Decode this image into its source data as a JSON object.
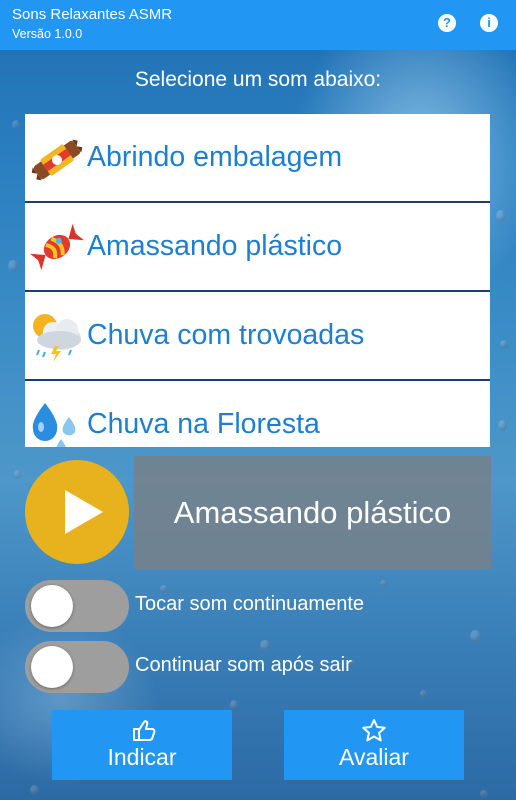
{
  "appbar": {
    "title": "Sons Relaxantes ASMR",
    "version": "Versão 1.0.0",
    "help_icon": "?",
    "info_icon": "i"
  },
  "prompt": "Selecione um som abaixo:",
  "sounds": [
    {
      "label": "Abrindo embalagem",
      "icon": "candy-bar-icon"
    },
    {
      "label": "Amassando plástico",
      "icon": "wrapped-candy-icon"
    },
    {
      "label": "Chuva com trovoadas",
      "icon": "thunderstorm-cloud-icon"
    },
    {
      "label": "Chuva na Floresta",
      "icon": "raindrops-icon"
    }
  ],
  "player": {
    "current_sound": "Amassando plástico",
    "play_icon": "play-icon"
  },
  "options": {
    "loop_label": "Tocar som continuamente",
    "loop_on": false,
    "background_label": "Continuar som após sair",
    "background_on": false
  },
  "buttons": {
    "share_label": "Indicar",
    "share_icon": "thumbs-up-icon",
    "rate_label": "Avaliar",
    "rate_icon": "star-icon"
  },
  "colors": {
    "appbar": "#2196f3",
    "play": "#e8b21f",
    "list_text": "#1e7fd0",
    "now_playing_bg": "#787f88",
    "toggle_off": "#9e9e9e"
  }
}
